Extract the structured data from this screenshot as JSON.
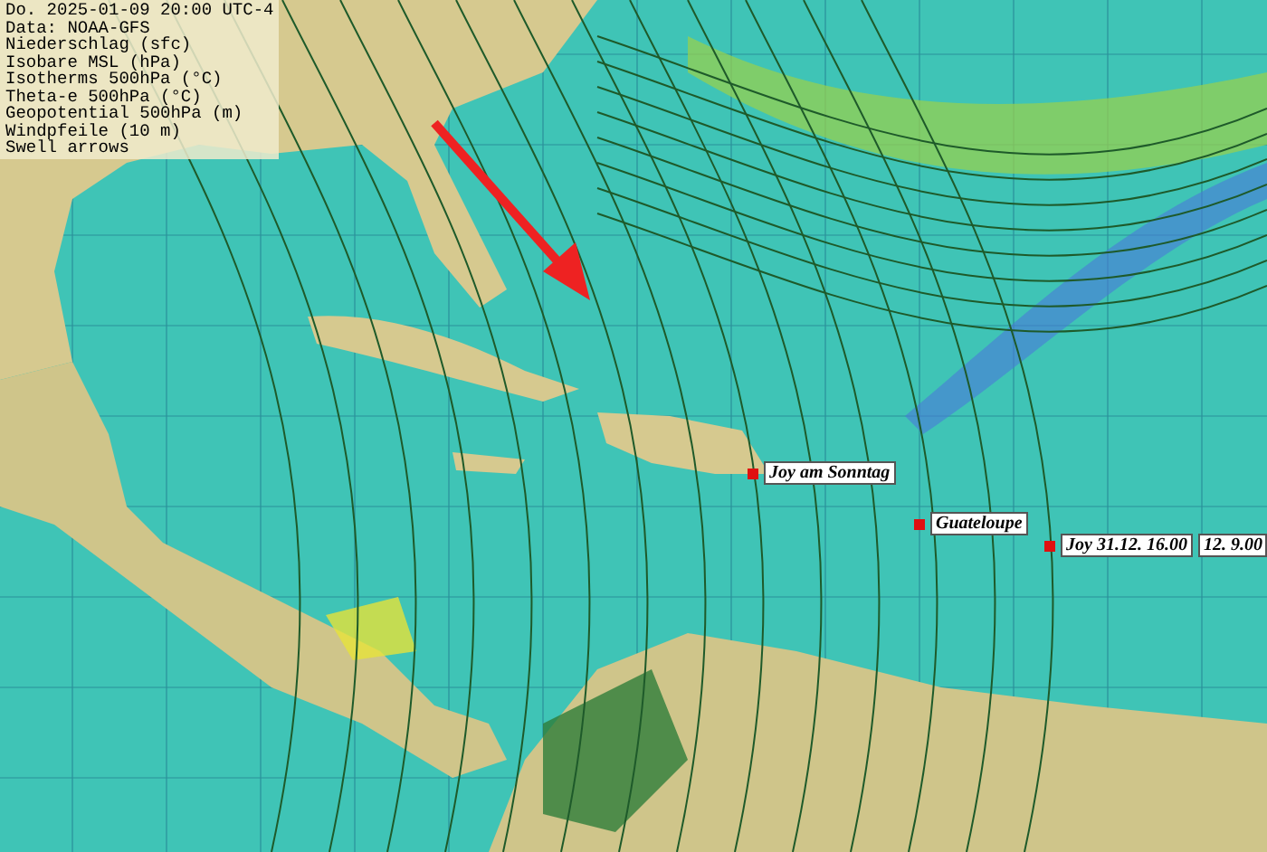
{
  "legend": {
    "title": "Do. 2025-01-09 20:00 UTC-4",
    "lines": [
      "Data: NOAA-GFS",
      "Niederschlag (sfc)",
      "Isobare MSL (hPa)",
      "Isotherms 500hPa (°C)",
      "Theta-e 500hPa (°C)",
      "Geopotential 500hPa (m)",
      "Windpfeile (10 m)",
      "Swell arrows"
    ]
  },
  "waypoints": [
    {
      "label": "Joy am Sonntag"
    },
    {
      "label": "Guateloupe"
    },
    {
      "label": "Joy 31.12. 16.00",
      "extra": "12. 9.00"
    }
  ]
}
